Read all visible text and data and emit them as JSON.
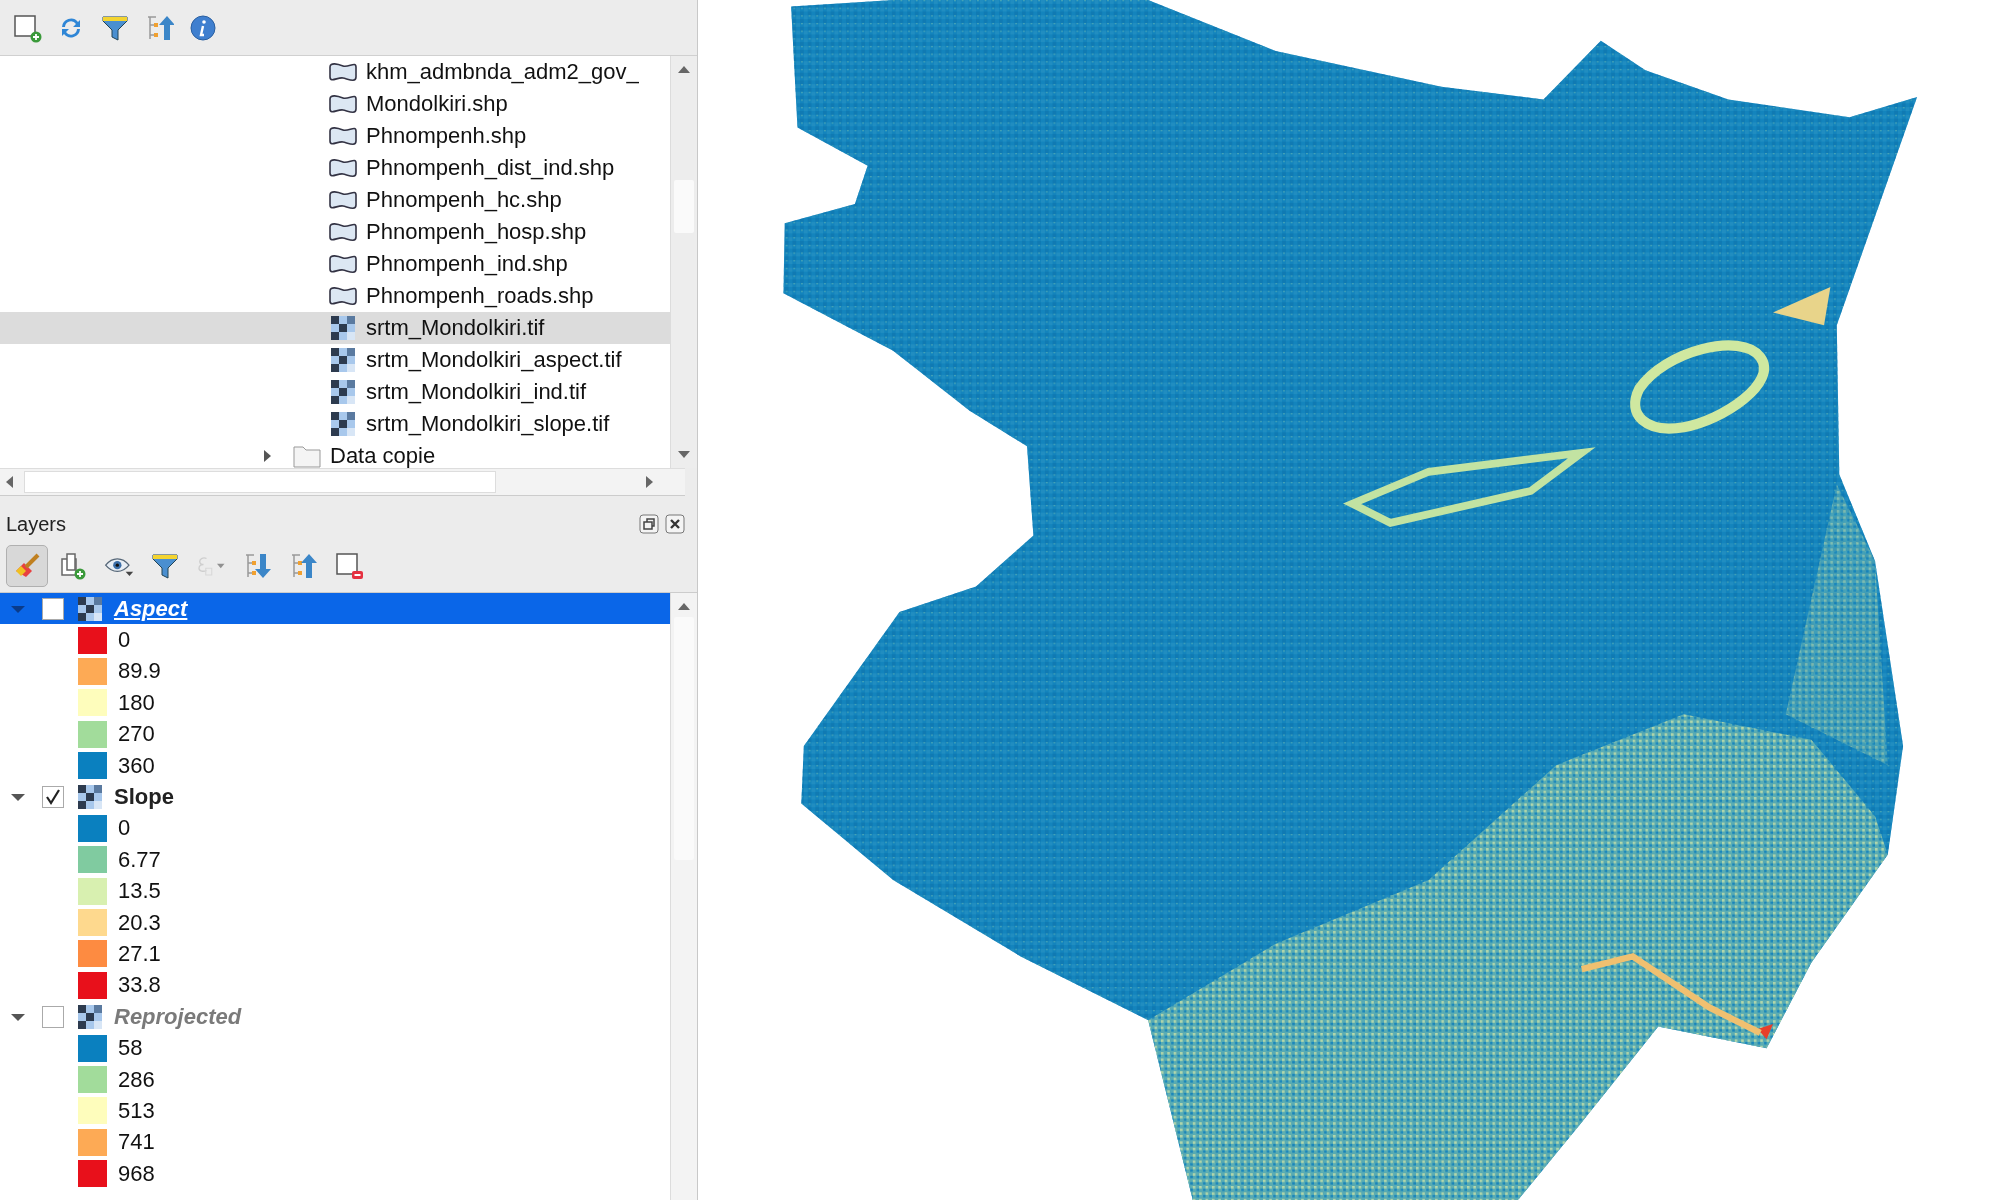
{
  "browser": {
    "items": [
      {
        "name": "khm_admbnda_adm2_gov_",
        "kind": "vector",
        "selected": false
      },
      {
        "name": "Mondolkiri.shp",
        "kind": "vector",
        "selected": false
      },
      {
        "name": "Phnompenh.shp",
        "kind": "vector",
        "selected": false
      },
      {
        "name": "Phnompenh_dist_ind.shp",
        "kind": "vector",
        "selected": false
      },
      {
        "name": "Phnompenh_hc.shp",
        "kind": "vector",
        "selected": false
      },
      {
        "name": "Phnompenh_hosp.shp",
        "kind": "vector",
        "selected": false
      },
      {
        "name": "Phnompenh_ind.shp",
        "kind": "vector",
        "selected": false
      },
      {
        "name": "Phnompenh_roads.shp",
        "kind": "vector",
        "selected": false
      },
      {
        "name": "srtm_Mondolkiri.tif",
        "kind": "raster",
        "selected": true
      },
      {
        "name": "srtm_Mondolkiri_aspect.tif",
        "kind": "raster",
        "selected": false
      },
      {
        "name": "srtm_Mondolkiri_ind.tif",
        "kind": "raster",
        "selected": false
      },
      {
        "name": "srtm_Mondolkiri_slope.tif",
        "kind": "raster",
        "selected": false
      },
      {
        "name": "Data copie",
        "kind": "folder",
        "expanded": false,
        "selected": false
      }
    ]
  },
  "layers_panel": {
    "title": "Layers",
    "toolbar": [
      {
        "kind": "style",
        "pressed": true,
        "disabled": false
      },
      {
        "kind": "add-group",
        "pressed": false,
        "disabled": false
      },
      {
        "kind": "visibility",
        "pressed": false,
        "disabled": false
      },
      {
        "kind": "filter",
        "pressed": false,
        "disabled": false
      },
      {
        "kind": "expression",
        "pressed": false,
        "disabled": true
      },
      {
        "kind": "expand",
        "pressed": false,
        "disabled": false
      },
      {
        "kind": "collapse",
        "pressed": false,
        "disabled": false
      },
      {
        "kind": "remove",
        "pressed": false,
        "disabled": false
      }
    ],
    "layers": [
      {
        "name": "Aspect",
        "expanded": true,
        "checked": false,
        "selected": true,
        "legend": [
          {
            "label": "0",
            "color": "#e8101b"
          },
          {
            "label": "89.9",
            "color": "#fdaa55"
          },
          {
            "label": "180",
            "color": "#fefdbc"
          },
          {
            "label": "270",
            "color": "#a2dc9b"
          },
          {
            "label": "360",
            "color": "#0a80bf"
          }
        ]
      },
      {
        "name": "Slope",
        "expanded": true,
        "checked": true,
        "selected": false,
        "legend": [
          {
            "label": "0",
            "color": "#0a80bf"
          },
          {
            "label": "6.77",
            "color": "#80cba0"
          },
          {
            "label": "13.5",
            "color": "#d8f0b0"
          },
          {
            "label": "20.3",
            "color": "#fed98e"
          },
          {
            "label": "27.1",
            "color": "#fd8b41"
          },
          {
            "label": "33.8",
            "color": "#e8101b"
          }
        ]
      },
      {
        "name": "Reprojected",
        "expanded": true,
        "checked": false,
        "selected": false,
        "legend": [
          {
            "label": "58",
            "color": "#0a80bf"
          },
          {
            "label": "286",
            "color": "#a2dc9b"
          },
          {
            "label": "513",
            "color": "#fefdbc"
          },
          {
            "label": "741",
            "color": "#fdaa55"
          },
          {
            "label": "968",
            "color": "#e8101b"
          }
        ]
      }
    ]
  }
}
